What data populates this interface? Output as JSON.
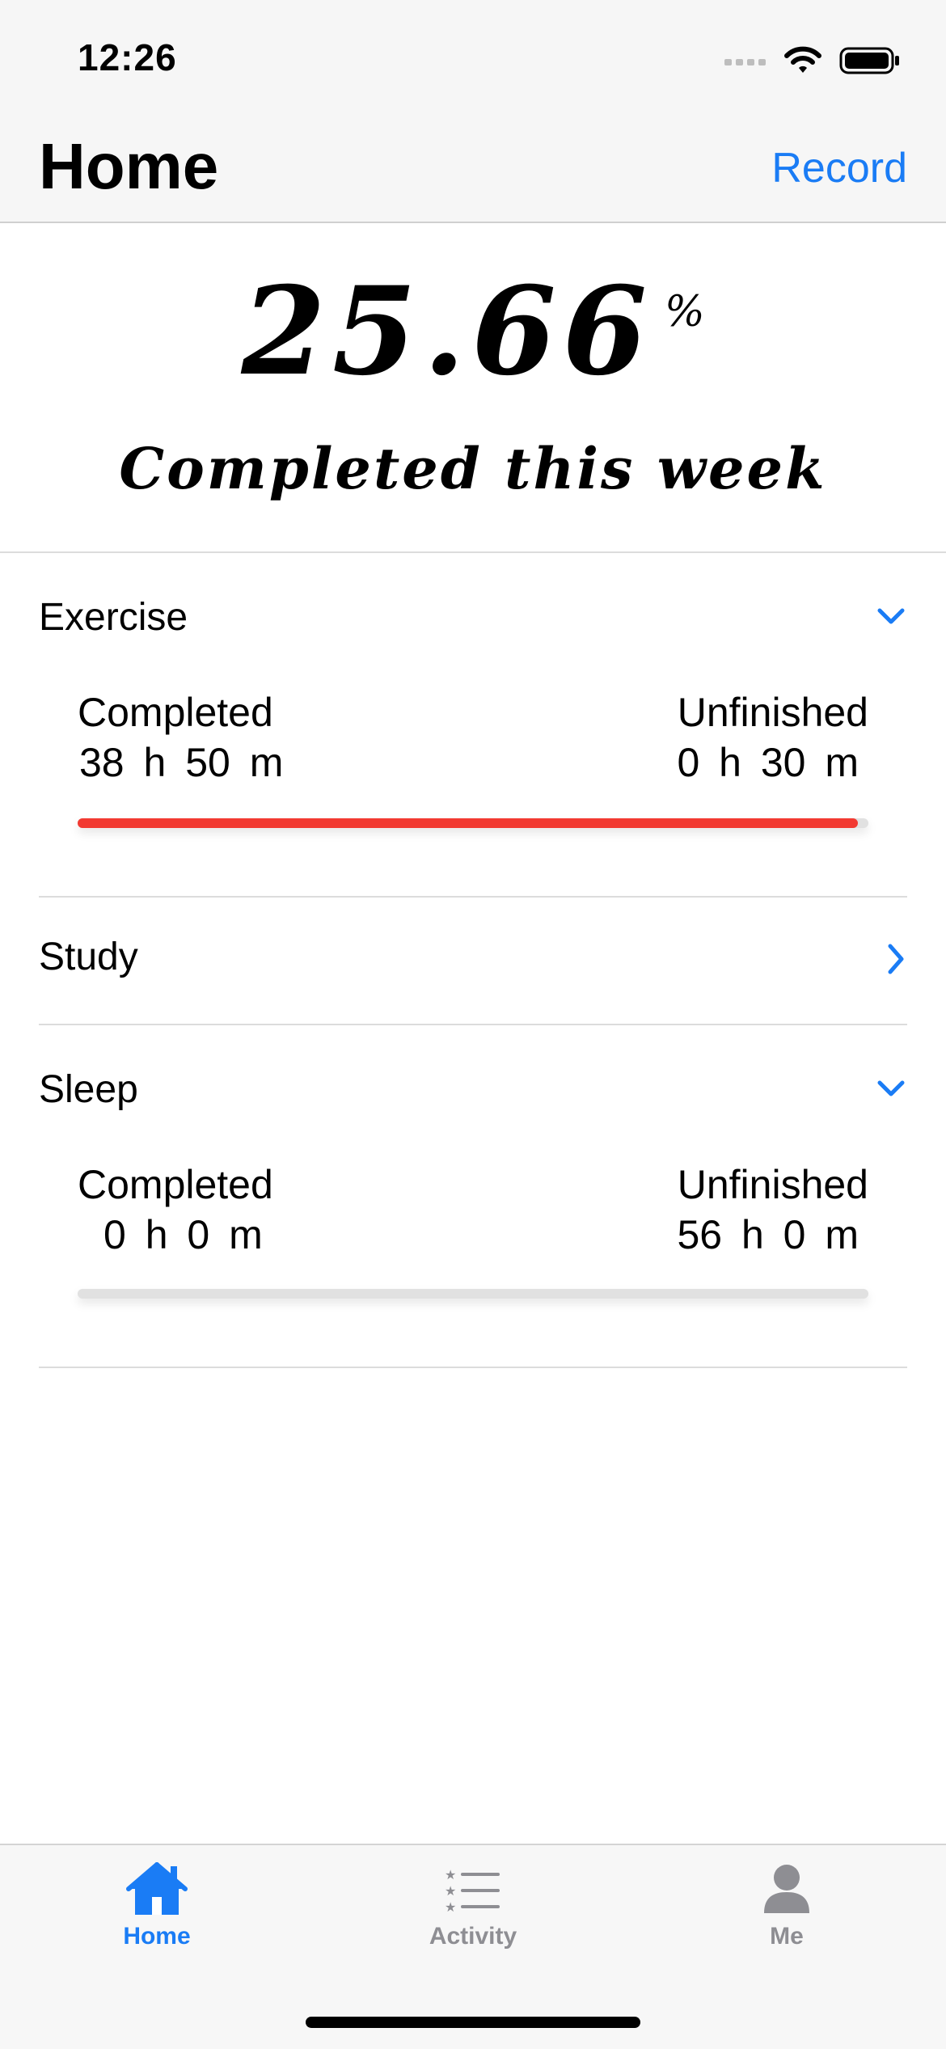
{
  "status_bar": {
    "time": "12:26"
  },
  "nav": {
    "title": "Home",
    "action_label": "Record"
  },
  "summary": {
    "percent": "25.66",
    "percent_sign": "%",
    "caption": "Completed this week"
  },
  "sections": [
    {
      "name": "Exercise",
      "expanded": true,
      "completed_label": "Completed",
      "completed_value": "38 h  50 m",
      "unfinished_label": "Unfinished",
      "unfinished_value": "0 h  30 m",
      "progress_fraction": 0.987
    },
    {
      "name": "Study",
      "expanded": false
    },
    {
      "name": "Sleep",
      "expanded": true,
      "completed_label": "Completed",
      "completed_value": "0 h  0 m",
      "unfinished_label": "Unfinished",
      "unfinished_value": "56 h  0 m",
      "progress_fraction": 0.0
    }
  ],
  "tabs": [
    {
      "label": "Home",
      "icon": "house-icon",
      "active": true
    },
    {
      "label": "Activity",
      "icon": "list-icon",
      "active": false
    },
    {
      "label": "Me",
      "icon": "person-icon",
      "active": false
    }
  ],
  "colors": {
    "accent": "#1a7cf5",
    "progress": "#f23a32",
    "inactive": "#8e8e93"
  }
}
